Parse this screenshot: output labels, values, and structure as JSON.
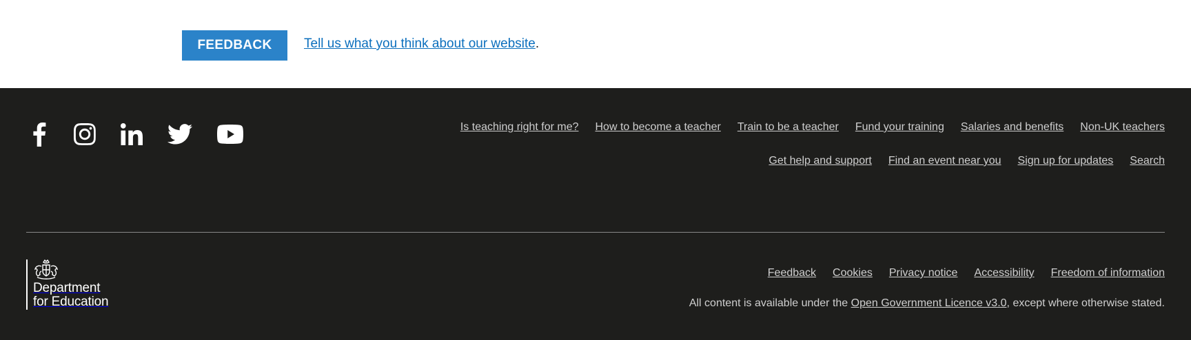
{
  "feedback": {
    "button_label": "FEEDBACK",
    "link_text": "Tell us what you think about our website",
    "suffix": "."
  },
  "social": [
    {
      "name": "facebook-icon"
    },
    {
      "name": "instagram-icon"
    },
    {
      "name": "linkedin-icon"
    },
    {
      "name": "twitter-icon"
    },
    {
      "name": "youtube-icon"
    }
  ],
  "nav": {
    "row1": [
      "Is teaching right for me?",
      "How to become a teacher",
      "Train to be a teacher",
      "Fund your training",
      "Salaries and benefits",
      "Non-UK teachers"
    ],
    "row2": [
      "Get help and support",
      "Find an event near you",
      "Sign up for updates",
      "Search"
    ]
  },
  "logo": {
    "line1": "Department",
    "line2": "for Education",
    "icon": "royal-crest-icon"
  },
  "legal": {
    "links": [
      "Feedback",
      "Cookies",
      "Privacy notice",
      "Accessibility",
      "Freedom of information"
    ],
    "licence_prefix": "All content is available under the ",
    "licence_link": "Open Government Licence v3.0",
    "licence_suffix": ", except where otherwise stated."
  },
  "colors": {
    "feedback_button": "#2b83c9",
    "link_blue": "#0b6fbd",
    "footer_bg": "#1e1e1c",
    "footer_text": "#cfcfcf"
  }
}
